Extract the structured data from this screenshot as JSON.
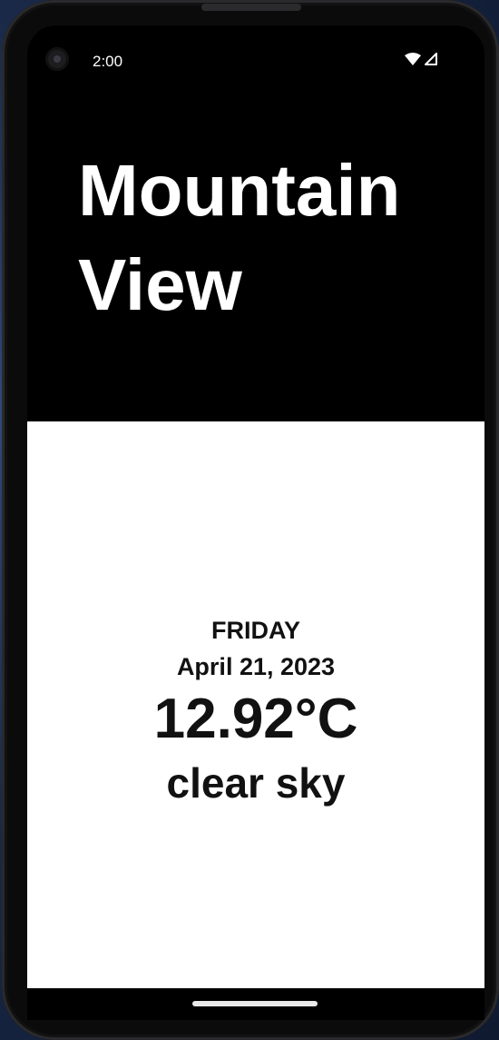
{
  "status_bar": {
    "time": "2:00",
    "icons": [
      "wifi-icon",
      "cellular-signal-icon"
    ]
  },
  "location": {
    "city": "Mountain View"
  },
  "weather": {
    "day": "FRIDAY",
    "date": "April 21, 2023",
    "temperature": "12.92°C",
    "description": "clear sky"
  },
  "colors": {
    "header_background": "#000000",
    "content_background": "#ffffff",
    "header_text": "#ffffff",
    "content_text": "#111111"
  }
}
